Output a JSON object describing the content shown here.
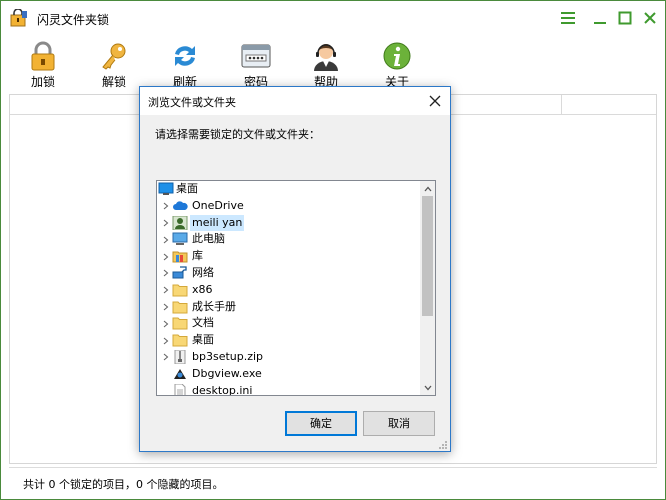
{
  "window": {
    "title": "闪灵文件夹锁"
  },
  "toolbar": {
    "items": [
      {
        "label": "加锁",
        "icon": "padlock-icon"
      },
      {
        "label": "解锁",
        "icon": "key-icon"
      },
      {
        "label": "刷新",
        "icon": "refresh-icon"
      },
      {
        "label": "密码",
        "icon": "password-card-icon"
      },
      {
        "label": "帮助",
        "icon": "support-agent-icon"
      },
      {
        "label": "关于",
        "icon": "info-icon"
      }
    ]
  },
  "status": {
    "text": "共计 0 个锁定的项目，0 个隐藏的项目。"
  },
  "dialog": {
    "title": "浏览文件或文件夹",
    "prompt": "请选择需要锁定的文件或文件夹：",
    "tree": [
      {
        "label": "桌面",
        "icon": "desktop-icon",
        "expandable": false,
        "selected": false,
        "level": 0
      },
      {
        "label": "OneDrive",
        "icon": "cloud-icon",
        "expandable": true,
        "selected": false,
        "level": 1
      },
      {
        "label": "meili yan",
        "icon": "user-icon",
        "expandable": true,
        "selected": true,
        "level": 1
      },
      {
        "label": "此电脑",
        "icon": "computer-icon",
        "expandable": true,
        "selected": false,
        "level": 1
      },
      {
        "label": "库",
        "icon": "library-icon",
        "expandable": true,
        "selected": false,
        "level": 1
      },
      {
        "label": "网络",
        "icon": "network-icon",
        "expandable": true,
        "selected": false,
        "level": 1
      },
      {
        "label": "x86",
        "icon": "folder-icon",
        "expandable": true,
        "selected": false,
        "level": 1
      },
      {
        "label": "成长手册",
        "icon": "folder-icon",
        "expandable": true,
        "selected": false,
        "level": 1
      },
      {
        "label": "文档",
        "icon": "folder-icon",
        "expandable": true,
        "selected": false,
        "level": 1
      },
      {
        "label": "桌面",
        "icon": "folder-icon",
        "expandable": true,
        "selected": false,
        "level": 1
      },
      {
        "label": "bp3setup.zip",
        "icon": "zip-icon",
        "expandable": true,
        "selected": false,
        "level": 1
      },
      {
        "label": "Dbgview.exe",
        "icon": "exe-icon",
        "expandable": false,
        "selected": false,
        "level": 1
      },
      {
        "label": "desktop.ini",
        "icon": "ini-file-icon",
        "expandable": false,
        "selected": false,
        "level": 1
      }
    ],
    "ok_label": "确定",
    "cancel_label": "取消"
  },
  "colors": {
    "accent_green": "#3f9a2e",
    "dialog_border": "#2c78c8",
    "selection": "#cce8ff"
  }
}
